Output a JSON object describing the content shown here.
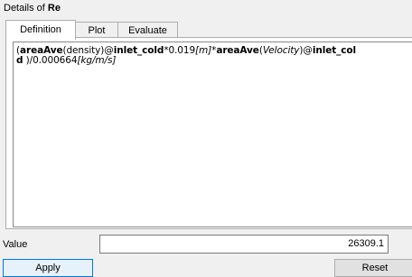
{
  "window": {
    "title_prefix": "Details of",
    "title_object": "Re"
  },
  "tabs": [
    {
      "label": "Definition",
      "active": true
    },
    {
      "label": "Plot",
      "active": false
    },
    {
      "label": "Evaluate",
      "active": false
    }
  ],
  "expression": {
    "line1": [
      {
        "text": "(",
        "style": "normal"
      },
      {
        "text": "areaAve",
        "style": "bold"
      },
      {
        "text": "(density)@",
        "style": "normal"
      },
      {
        "text": "inlet_cold",
        "style": "bold"
      },
      {
        "text": "*0.019",
        "style": "normal"
      },
      {
        "text": "[m]",
        "style": "italic"
      },
      {
        "text": "*",
        "style": "normal"
      },
      {
        "text": "areaAve",
        "style": "bold"
      },
      {
        "text": "(",
        "style": "normal"
      },
      {
        "text": "Velocity",
        "style": "italic"
      },
      {
        "text": ")@",
        "style": "normal"
      },
      {
        "text": "inlet_col",
        "style": "bold"
      }
    ],
    "line2": [
      {
        "text": "d",
        "style": "bold"
      },
      {
        "text": " )/0.000664",
        "style": "normal"
      },
      {
        "text": "[kg/m/s]",
        "style": "italic"
      }
    ]
  },
  "value": {
    "label": "Value",
    "field": "26309.1"
  },
  "buttons": {
    "apply_label": "Apply",
    "reset_label": "Reset"
  }
}
